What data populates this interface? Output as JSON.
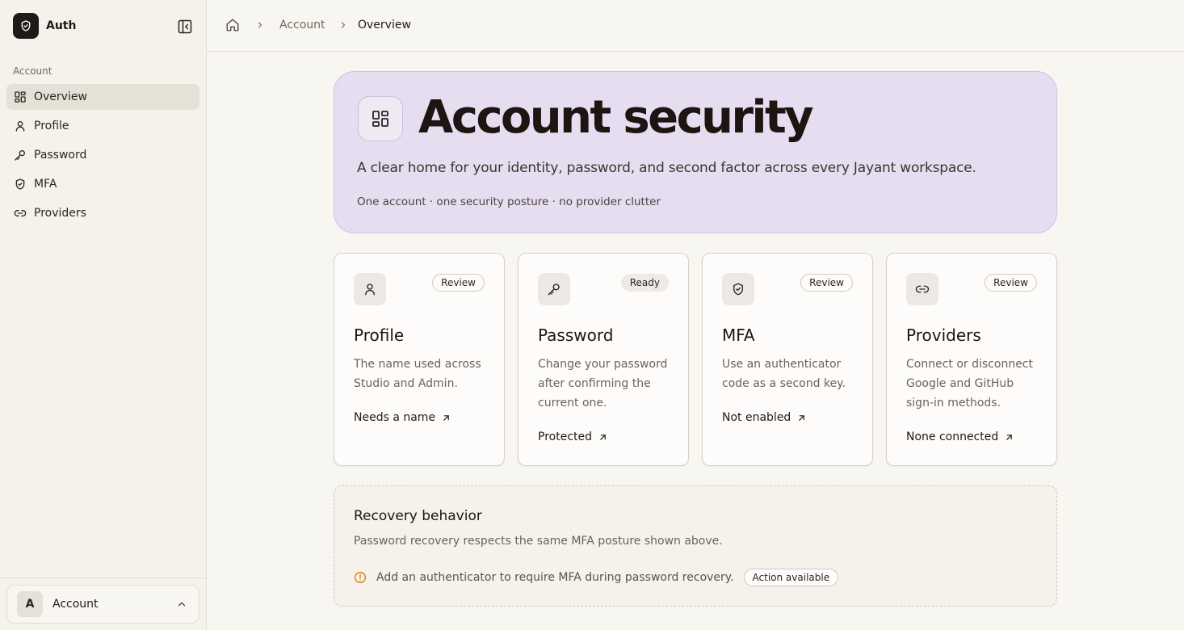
{
  "brand": {
    "name": "Auth",
    "logo_icon": "shield-check-icon"
  },
  "sidebar": {
    "section_label": "Account",
    "items": [
      {
        "label": "Overview",
        "icon": "grid-icon",
        "active": true
      },
      {
        "label": "Profile",
        "icon": "user-icon",
        "active": false
      },
      {
        "label": "Password",
        "icon": "key-icon",
        "active": false
      },
      {
        "label": "MFA",
        "icon": "shield-check-icon",
        "active": false
      },
      {
        "label": "Providers",
        "icon": "link-icon",
        "active": false
      }
    ],
    "account": {
      "avatar_letter": "A",
      "label": "Account"
    }
  },
  "breadcrumb": {
    "parent": "Account",
    "current": "Overview"
  },
  "hero": {
    "title": "Account security",
    "subtitle": "A clear home for your identity, password, and second factor across every Jayant workspace.",
    "meta": "One account · one security posture · no provider clutter"
  },
  "cards": [
    {
      "title": "Profile",
      "badge": "Review",
      "description": "The name used across Studio and Admin.",
      "link": "Needs a name",
      "icon": "user-icon"
    },
    {
      "title": "Password",
      "badge": "Ready",
      "description": "Change your password after confirming the current one.",
      "link": "Protected",
      "icon": "key-icon"
    },
    {
      "title": "MFA",
      "badge": "Review",
      "description": "Use an authenticator code as a second key.",
      "link": "Not enabled",
      "icon": "shield-check-icon"
    },
    {
      "title": "Providers",
      "badge": "Review",
      "description": "Connect or disconnect Google and GitHub sign-in methods.",
      "link": "None connected",
      "icon": "link-icon"
    }
  ],
  "recovery": {
    "title": "Recovery behavior",
    "description": "Password recovery respects the same MFA posture shown above.",
    "notice": "Add an authenticator to require MFA during password recovery.",
    "action": "Action available"
  },
  "colors": {
    "hero_bg": "#e6ddf0",
    "active_nav_bg": "#e3e2d7",
    "warning": "#d97706"
  }
}
